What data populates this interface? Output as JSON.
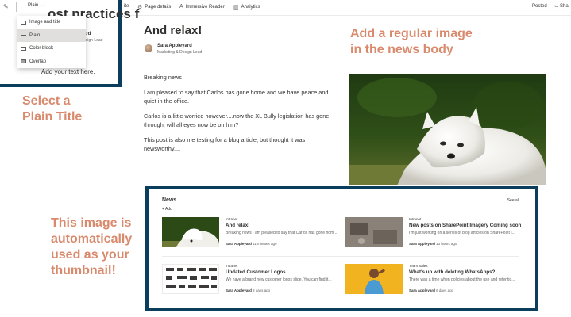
{
  "command_bar": {
    "items": [
      {
        "label": "ite",
        "icon": "partial-icon"
      },
      {
        "label": "Page details",
        "icon": "gear-icon"
      },
      {
        "label": "Immersive Reader",
        "icon": "reader-icon"
      },
      {
        "label": "Analytics",
        "icon": "chart-icon"
      }
    ],
    "status": "Posted",
    "share": "Sha"
  },
  "title_panel": {
    "layout_value": "Plain",
    "ghost_title": "ost practices f",
    "ghost_author": "ard",
    "ghost_role": "esign Lead",
    "body_placeholder": "Add your text here.",
    "menu": [
      {
        "label": "Image and title",
        "selected": false
      },
      {
        "label": "Plain",
        "selected": true
      },
      {
        "label": "Color block",
        "selected": false
      },
      {
        "label": "Overlap",
        "selected": false
      }
    ]
  },
  "annotations": {
    "select_plain_line1": "Select a",
    "select_plain_line2": "Plain Title",
    "regular_image_line1": "Add a regular image",
    "regular_image_line2": "in the news body",
    "thumbnail_line1": "This image is",
    "thumbnail_line2": "automatically",
    "thumbnail_line3": "used as your",
    "thumbnail_line4": "thumbnail!",
    "color": "#d98a6d"
  },
  "article": {
    "title": "And relax!",
    "author": "Sara Appleyard",
    "role": "Marketing & Design Lead",
    "paragraphs": [
      "Breaking news",
      "I am pleased to say that Carlos has gone home and we have peace and quiet in the office.",
      "Carlos is a little worried however....now the XL Bully legislation has gone through, will all eyes now be on him?",
      "This post is also me testing for a blog article, but thought it was newsworthy...."
    ]
  },
  "news": {
    "heading": "News",
    "add_label": "+ Add",
    "see_all": "See all",
    "items": [
      {
        "category": "Intranet",
        "title": "And relax!",
        "snippet": "Breaking news I am pleased to say that Carlos has gone hom...",
        "author": "Sara Appleyard",
        "time": "11 minutes ago"
      },
      {
        "category": "Intranet",
        "title": "New posts on SharePoint Imagery Coming soon",
        "snippet": "I'm just working on a series of blog articles on SharePoint I...",
        "author": "Sara Appleyard",
        "time": "13 hours ago"
      },
      {
        "category": "Intranet",
        "title": "Updated Customer Logos",
        "snippet": "We have a brand new customer logos slide. You can find it...",
        "author": "Sara Appleyard",
        "time": "2 days ago"
      },
      {
        "category": "Team Sales",
        "title": "What's up with deleting WhatsApps?",
        "snippet": "There was a time when policies about the use and retentio...",
        "author": "Sara Appleyard",
        "time": "6 days ago"
      }
    ]
  },
  "colors": {
    "frame": "#0b3d5c",
    "accent": "#d98a6d"
  }
}
